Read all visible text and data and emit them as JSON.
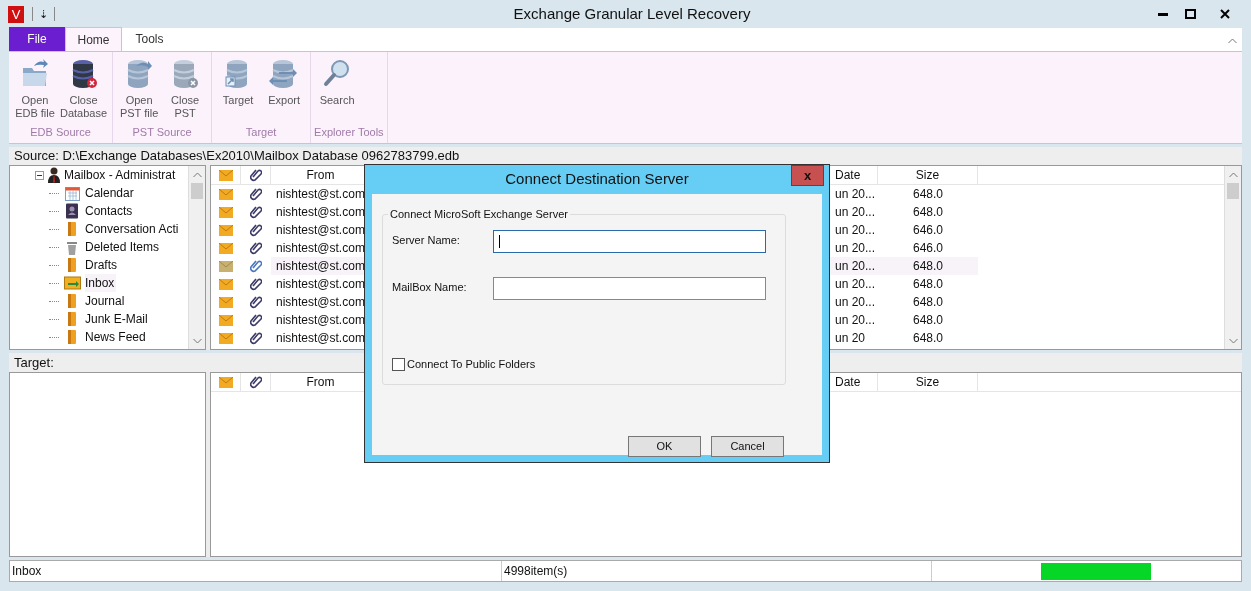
{
  "window": {
    "title": "Exchange Granular Level Recovery",
    "app_letter": "V",
    "qat_glyph": "⇣"
  },
  "ribbon_tabs": [
    {
      "label": "File",
      "kind": "file",
      "selected": false
    },
    {
      "label": "Home",
      "kind": "tab",
      "selected": true
    },
    {
      "label": "Tools",
      "kind": "tab",
      "selected": false
    }
  ],
  "ribbon_groups": [
    {
      "label": "EDB Source",
      "buttons": [
        {
          "label": "Open\nEDB file",
          "kind": "folder"
        },
        {
          "label": "Close\nDatabase",
          "kind": "db-close"
        }
      ]
    },
    {
      "label": "PST Source",
      "buttons": [
        {
          "label": "Open\nPST file",
          "kind": "db-open"
        },
        {
          "label": "Close\nPST",
          "kind": "db-close-grey"
        }
      ]
    },
    {
      "label": "Target",
      "buttons": [
        {
          "label": "Target",
          "kind": "db-target"
        },
        {
          "label": "Export",
          "kind": "db-export"
        }
      ]
    },
    {
      "label": "Explorer Tools",
      "buttons": [
        {
          "label": "Search",
          "kind": "search"
        }
      ]
    }
  ],
  "source_path": "Source: D:\\Exchange Databases\\Ex2010\\Mailbox Database 0962783799.edb",
  "tree": [
    {
      "label": "Mailbox - Administrat",
      "kind": "user",
      "expanded": true,
      "children": [
        {
          "label": "Calendar",
          "kind": "calendar",
          "selected": false
        },
        {
          "label": "Contacts",
          "kind": "contacts",
          "selected": false
        },
        {
          "label": "Conversation Acti",
          "kind": "folder",
          "selected": false
        },
        {
          "label": "Deleted Items",
          "kind": "trash",
          "selected": false
        },
        {
          "label": "Drafts",
          "kind": "folder",
          "selected": false
        },
        {
          "label": "Inbox",
          "kind": "inbox",
          "selected": true
        },
        {
          "label": "Journal",
          "kind": "folder",
          "selected": false
        },
        {
          "label": "Junk E-Mail",
          "kind": "folder",
          "selected": false
        },
        {
          "label": "News Feed",
          "kind": "folder",
          "selected": false
        }
      ]
    }
  ],
  "mail_columns": {
    "from": "From",
    "date": "Date",
    "size": "Size"
  },
  "mail_rows": [
    {
      "from": "nishtest@st.com",
      "date": "un 20...",
      "size": "648.0",
      "selected": false
    },
    {
      "from": "nishtest@st.com",
      "date": "un 20...",
      "size": "648.0",
      "selected": false
    },
    {
      "from": "nishtest@st.com",
      "date": "un 20...",
      "size": "646.0",
      "selected": false
    },
    {
      "from": "nishtest@st.com",
      "date": "un 20...",
      "size": "646.0",
      "selected": false
    },
    {
      "from": "nishtest@st.com",
      "date": "un 20...",
      "size": "648.0",
      "selected": true
    },
    {
      "from": "nishtest@st.com",
      "date": "un 20...",
      "size": "648.0",
      "selected": false
    },
    {
      "from": "nishtest@st.com",
      "date": "un 20...",
      "size": "648.0",
      "selected": false
    },
    {
      "from": "nishtest@st.com",
      "date": "un 20...",
      "size": "648.0",
      "selected": false
    },
    {
      "from": "nishtest@st.com",
      "date": "un 20",
      "size": "648.0",
      "selected": false
    }
  ],
  "target_label": "Target:",
  "target_columns": {
    "from": "From",
    "date": "Date",
    "size": "Size"
  },
  "dialog": {
    "title": "Connect Destination Server",
    "close": "x",
    "group_label": "Connect MicroSoft Exchange Server",
    "fields": [
      {
        "label": "Server Name:",
        "focused": true
      },
      {
        "label": "MailBox Name:",
        "focused": false
      }
    ],
    "checkbox": {
      "label": "Connect To Public Folders",
      "checked": false
    },
    "buttons": [
      "OK",
      "Cancel"
    ]
  },
  "status_bar": {
    "folder": "Inbox",
    "count": "4998item(s)",
    "progress": {
      "level": 1
    }
  }
}
